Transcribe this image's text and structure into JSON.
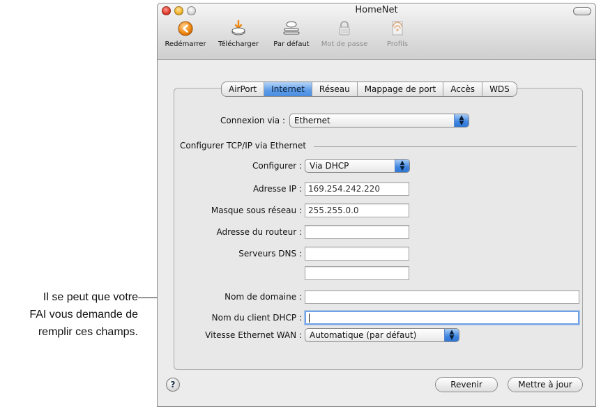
{
  "callout": {
    "line1": "Il se peut que votre",
    "line2": "FAI vous demande de",
    "line3": "remplir ces champs."
  },
  "window": {
    "title": "HomeNet"
  },
  "toolbar": {
    "items": [
      {
        "label": "Redémarrer",
        "icon": "restart-icon",
        "enabled": true
      },
      {
        "label": "Télécharger",
        "icon": "download-icon",
        "enabled": true
      },
      {
        "label": "Par défaut",
        "icon": "default-icon",
        "enabled": true
      },
      {
        "label": "Mot de passe",
        "icon": "lock-icon",
        "enabled": false
      },
      {
        "label": "Profils",
        "icon": "profiles-icon",
        "enabled": false
      }
    ]
  },
  "tabs": [
    {
      "label": "AirPort"
    },
    {
      "label": "Internet",
      "active": true
    },
    {
      "label": "Réseau"
    },
    {
      "label": "Mappage de port"
    },
    {
      "label": "Accès"
    },
    {
      "label": "WDS"
    }
  ],
  "form": {
    "connexion_label": "Connexion via :",
    "connexion_value": "Ethernet",
    "section_title": "Configurer TCP/IP via Ethernet",
    "configurer_label": "Configurer :",
    "configurer_value": "Via DHCP",
    "ip_label": "Adresse IP :",
    "ip_value": "169.254.242.220",
    "mask_label": "Masque sous réseau :",
    "mask_value": "255.255.0.0",
    "router_label": "Adresse du routeur :",
    "router_value": "",
    "dns_label": "Serveurs DNS :",
    "dns1_value": "",
    "dns2_value": "",
    "domain_label": "Nom de domaine :",
    "domain_value": "",
    "dhcp_client_label": "Nom du client DHCP :",
    "dhcp_client_value": "",
    "wan_speed_label": "Vitesse Ethernet WAN :",
    "wan_speed_value": "Automatique (par défaut)"
  },
  "buttons": {
    "help": "?",
    "revert": "Revenir",
    "update": "Mettre à jour"
  },
  "colors": {
    "accent_blue": "#4a8de2",
    "window_bg": "#ececec"
  }
}
